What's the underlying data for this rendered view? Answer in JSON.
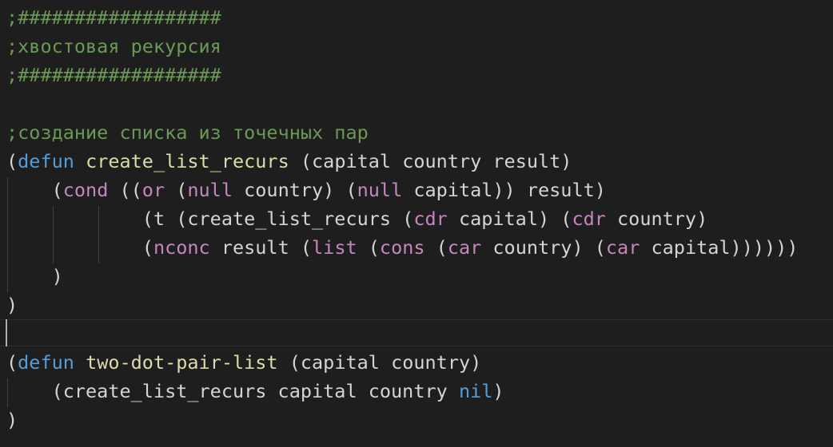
{
  "editor": {
    "language": "lisp",
    "colors": {
      "background": "#1e1e1e",
      "text": "#d4d4d4",
      "comment": "#6a9955",
      "defun": "#569cd6",
      "function_name": "#dcdcaa",
      "builtin": "#c586c0"
    },
    "lines": [
      {
        "tokens": [
          {
            "t": ";##################",
            "k": "comment"
          }
        ]
      },
      {
        "tokens": [
          {
            "t": ";хвостовая рекурсия",
            "k": "comment"
          }
        ]
      },
      {
        "tokens": [
          {
            "t": ";##################",
            "k": "comment"
          }
        ]
      },
      {
        "tokens": []
      },
      {
        "tokens": [
          {
            "t": ";создание списка из точечных пар",
            "k": "comment"
          }
        ]
      },
      {
        "tokens": [
          {
            "t": "(",
            "k": "sym"
          },
          {
            "t": "defun",
            "k": "def"
          },
          {
            "t": " ",
            "k": "sym"
          },
          {
            "t": "create_list_recurs",
            "k": "fn"
          },
          {
            "t": " (capital country result)",
            "k": "sym"
          }
        ]
      },
      {
        "tokens": [
          {
            "t": "    (",
            "k": "sym"
          },
          {
            "t": "cond",
            "k": "kw"
          },
          {
            "t": " ((",
            "k": "sym"
          },
          {
            "t": "or",
            "k": "kw"
          },
          {
            "t": " (",
            "k": "sym"
          },
          {
            "t": "null",
            "k": "kw"
          },
          {
            "t": " country) (",
            "k": "sym"
          },
          {
            "t": "null",
            "k": "kw"
          },
          {
            "t": " capital)) result)",
            "k": "sym"
          }
        ]
      },
      {
        "tokens": [
          {
            "t": "            (t (create_list_recurs (",
            "k": "sym"
          },
          {
            "t": "cdr",
            "k": "kw"
          },
          {
            "t": " capital) (",
            "k": "sym"
          },
          {
            "t": "cdr",
            "k": "kw"
          },
          {
            "t": " country)",
            "k": "sym"
          }
        ]
      },
      {
        "tokens": [
          {
            "t": "            (",
            "k": "sym"
          },
          {
            "t": "nconc",
            "k": "kw"
          },
          {
            "t": " result (",
            "k": "sym"
          },
          {
            "t": "list",
            "k": "kw"
          },
          {
            "t": " (",
            "k": "sym"
          },
          {
            "t": "cons",
            "k": "kw"
          },
          {
            "t": " (",
            "k": "sym"
          },
          {
            "t": "car",
            "k": "kw"
          },
          {
            "t": " country) (",
            "k": "sym"
          },
          {
            "t": "car",
            "k": "kw"
          },
          {
            "t": " capital))))))",
            "k": "sym"
          }
        ]
      },
      {
        "tokens": [
          {
            "t": "    )",
            "k": "sym"
          }
        ]
      },
      {
        "tokens": [
          {
            "t": ")",
            "k": "sym"
          }
        ]
      },
      {
        "tokens": []
      },
      {
        "tokens": [
          {
            "t": "(",
            "k": "sym"
          },
          {
            "t": "defun",
            "k": "def"
          },
          {
            "t": " ",
            "k": "sym"
          },
          {
            "t": "two-dot-pair-list",
            "k": "fn"
          },
          {
            "t": " (capital country)",
            "k": "sym"
          }
        ]
      },
      {
        "tokens": [
          {
            "t": "    (create_list_recurs capital country ",
            "k": "sym"
          },
          {
            "t": "nil",
            "k": "def"
          },
          {
            "t": ")",
            "k": "sym"
          }
        ]
      },
      {
        "tokens": [
          {
            "t": ")",
            "k": "sym"
          }
        ]
      }
    ]
  }
}
